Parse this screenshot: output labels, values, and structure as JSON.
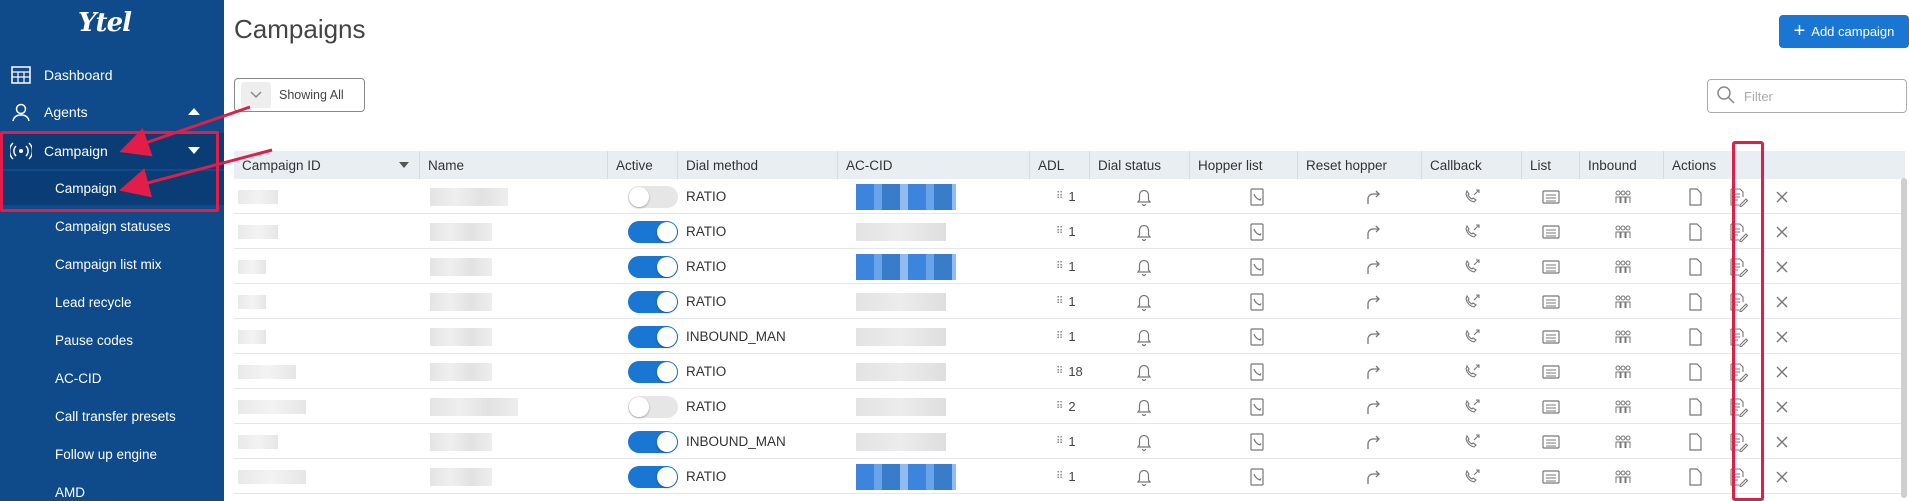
{
  "brand": "Ytel",
  "sidebar": {
    "items": [
      {
        "label": "Dashboard",
        "icon": "dashboard-icon"
      },
      {
        "label": "Agents",
        "icon": "agents-icon"
      },
      {
        "label": "Campaign",
        "icon": "broadcast-icon"
      }
    ],
    "sub_items": [
      "Campaign",
      "Campaign statuses",
      "Campaign list mix",
      "Lead recycle",
      "Pause codes",
      "AC-CID",
      "Call transfer presets",
      "Follow up engine",
      "AMD"
    ]
  },
  "header": {
    "title": "Campaigns",
    "add_label": "Add campaign",
    "showing_label": "Showing All",
    "filter_placeholder": "Filter"
  },
  "table": {
    "columns": [
      "Campaign ID",
      "Name",
      "Active",
      "Dial method",
      "AC-CID",
      "ADL",
      "Dial status",
      "Hopper list",
      "Reset hopper",
      "Callback",
      "List",
      "Inbound",
      "Actions"
    ],
    "rows": [
      {
        "active": false,
        "dial_method": "RATIO",
        "adl": "1",
        "accid": "blue"
      },
      {
        "active": true,
        "dial_method": "RATIO",
        "adl": "1",
        "accid": "gray"
      },
      {
        "active": true,
        "dial_method": "RATIO",
        "adl": "1",
        "accid": "blue"
      },
      {
        "active": true,
        "dial_method": "RATIO",
        "adl": "1",
        "accid": "gray"
      },
      {
        "active": true,
        "dial_method": "INBOUND_MAN",
        "adl": "1",
        "accid": "gray"
      },
      {
        "active": true,
        "dial_method": "RATIO",
        "adl": "18",
        "accid": "gray"
      },
      {
        "active": false,
        "dial_method": "RATIO",
        "adl": "2",
        "accid": "gray"
      },
      {
        "active": true,
        "dial_method": "INBOUND_MAN",
        "adl": "1",
        "accid": "gray"
      },
      {
        "active": true,
        "dial_method": "RATIO",
        "adl": "1",
        "accid": "blue"
      }
    ]
  },
  "colors": {
    "sidebar": "#0f4a8a",
    "accent": "#1976d2",
    "highlight": "#e11d48"
  }
}
